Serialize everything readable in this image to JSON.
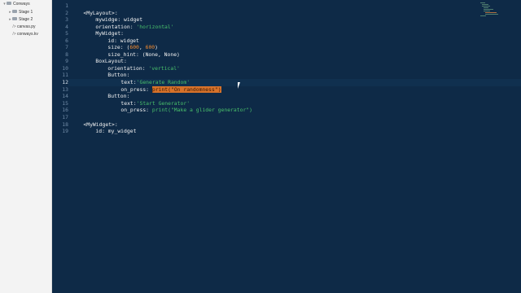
{
  "sidebar": {
    "items": [
      {
        "label": "Conways",
        "kind": "folder",
        "level": 0,
        "expanded": true
      },
      {
        "label": "Stage 1",
        "kind": "folder",
        "level": 1,
        "expanded": false
      },
      {
        "label": "Stage 2",
        "kind": "folder",
        "level": 1,
        "expanded": false
      },
      {
        "label": "canvas.py",
        "kind": "file",
        "level": 1
      },
      {
        "label": "conways.kv",
        "kind": "file",
        "level": 1
      }
    ]
  },
  "editor": {
    "line_numbers": [
      "1",
      "2",
      "3",
      "4",
      "5",
      "6",
      "7",
      "8",
      "9",
      "10",
      "11",
      "12",
      "13",
      "14",
      "15",
      "16",
      "17",
      "18",
      "19"
    ],
    "lines": {
      "l1": "<MyLayout>:",
      "l2_key": "mywidge:",
      "l2_val": " widget",
      "l3_key": "orientation:",
      "l3_val": " 'horizontal'",
      "l4": "MyWidget:",
      "l5_key": "id:",
      "l5_val": " widget",
      "l6_key": "size:",
      "l6_open": " (",
      "l6_n1": "600",
      "l6_comma": ", ",
      "l6_n2": "600",
      "l6_close": ")",
      "l7_key": "size_hint:",
      "l7_val": " (None, None)",
      "l8": "BoxLayout:",
      "l9_key": "orientation:",
      "l9_val": " 'vertical'",
      "l10": "Button:",
      "l11_key": "text:",
      "l11_val": "'Generate Random'",
      "l12_key": "on_press:",
      "l12_sel": "print(\"On randomness\")",
      "l13": "Button:",
      "l14_key": "text:",
      "l14_val": "'Start Generator'",
      "l15_key": "on_press:",
      "l15_val": " print(\"Make a glider generator\")",
      "l17": "<MyWidget>:",
      "l18_key": "id:",
      "l18_val": " my_widget"
    },
    "active_line": 12
  },
  "colors": {
    "background": "#0e2a47",
    "string": "#49c06b",
    "number": "#f28a2e",
    "selection": "#d7722a"
  }
}
